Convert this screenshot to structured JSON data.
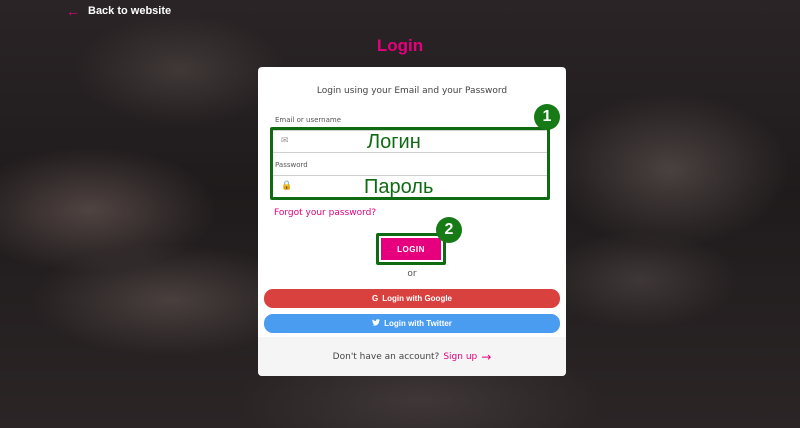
{
  "nav": {
    "back_label": "Back to website"
  },
  "page": {
    "title": "Login"
  },
  "card": {
    "subtitle": "Login using your Email and your Password",
    "email_label": "Email or username",
    "password_label": "Password",
    "forgot_label": "Forgot your password?",
    "login_button": "LOGIN",
    "or_label": "or",
    "google_button": "Login with Google",
    "twitter_button": "Login with Twitter",
    "no_account_text": "Don't have an account?",
    "signup_label": "Sign up"
  },
  "annotations": {
    "login_hint": "Логин",
    "password_hint": "Пароль",
    "step1": "1",
    "step2": "2"
  },
  "colors": {
    "accent": "#e6007e",
    "google": "#d9413f",
    "twitter": "#4a9cf0",
    "annotation": "#0f6b12"
  },
  "icons": {
    "email_field": "envelope-icon",
    "password_field": "lock-icon",
    "google": "google-icon",
    "twitter": "twitter-icon",
    "back": "arrow-left-icon",
    "signup": "arrow-right-icon"
  }
}
